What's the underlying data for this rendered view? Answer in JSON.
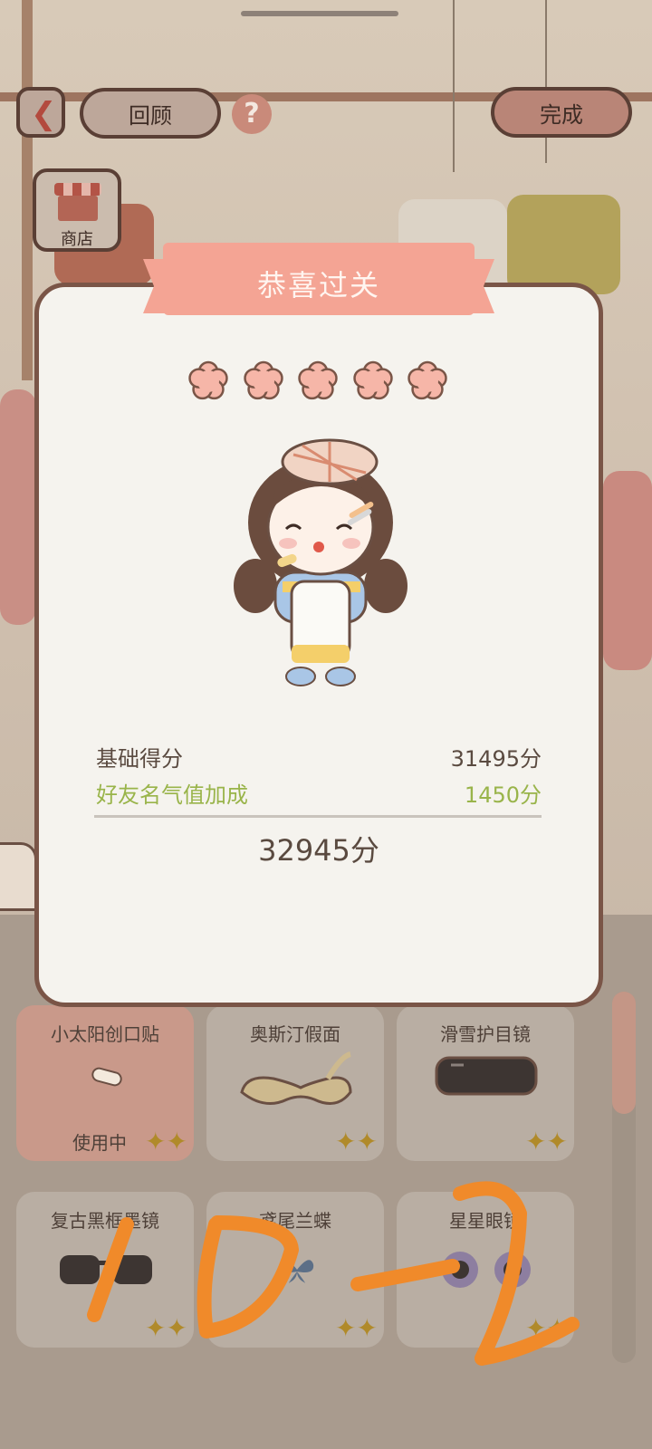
{
  "top_bar": {
    "back_icon": "chevron-left-icon",
    "review_label": "回顾",
    "help_label": "?",
    "done_label": "完成"
  },
  "shop": {
    "label": "商店",
    "icon": "shop-icon"
  },
  "result_dialog": {
    "title": "恭喜过关",
    "stars_earned": 5,
    "stars_total": 5,
    "base_score_label": "基础得分",
    "base_score_value": "31495分",
    "bonus_label": "好友名气值加成",
    "bonus_value": "1450分",
    "total_value": "32945分",
    "colors": {
      "ribbon": "#f4a494",
      "star": "#f6b6a8",
      "bonus": "#99b44a",
      "border": "#7a5547"
    }
  },
  "items": [
    {
      "name": "小太阳创口贴",
      "status": "使用中",
      "active": true
    },
    {
      "name": "奥斯汀假面",
      "status": "",
      "active": false
    },
    {
      "name": "滑雪护目镜",
      "status": "",
      "active": false
    },
    {
      "name": "复古黑框墨镜",
      "status": "",
      "active": false
    },
    {
      "name": "鸢尾兰蝶",
      "status": "",
      "active": false
    },
    {
      "name": "星星眼镜",
      "status": "",
      "active": false
    }
  ],
  "annotation": {
    "text": "10-2",
    "color": "#f08a2a"
  }
}
